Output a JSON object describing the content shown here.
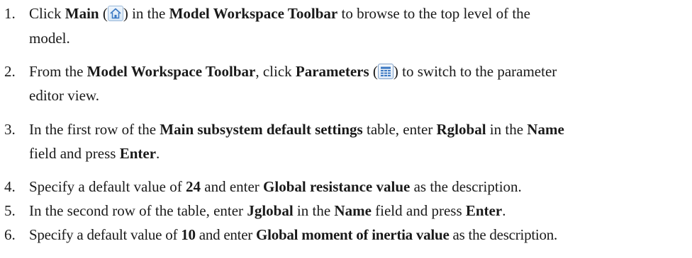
{
  "steps": [
    {
      "number": "1.",
      "parts": [
        "Click ",
        "Main",
        " (",
        ") in the ",
        "Model Workspace Toolbar",
        " to browse to the top level of the",
        "model."
      ],
      "icon": "home-icon"
    },
    {
      "number": "2.",
      "parts": [
        "From the ",
        "Model Workspace Toolbar",
        ", click ",
        "Parameters",
        " (",
        ") to switch to the parameter",
        "editor view."
      ],
      "icon": "parameters-table-icon"
    },
    {
      "number": "3.",
      "parts": [
        "In the first row of the ",
        "Main subsystem default settings",
        " table, enter ",
        "Rglobal",
        " in the ",
        "Name",
        "field and press ",
        "Enter",
        "."
      ]
    },
    {
      "number": "4.",
      "parts": [
        "Specify a default value of ",
        "24",
        " and enter ",
        "Global resistance value",
        " as the description."
      ]
    },
    {
      "number": "5.",
      "parts": [
        "In the second row of the table, enter ",
        "Jglobal",
        " in the ",
        "Name",
        " field and press ",
        "Enter",
        "."
      ]
    },
    {
      "number": "6.",
      "parts": [
        "Specify a default value of ",
        "10",
        " and enter ",
        "Global moment of inertia value",
        " as the description."
      ]
    }
  ],
  "colors": {
    "text": "#1a1a1a",
    "icon_blue": "#3a78c2"
  }
}
